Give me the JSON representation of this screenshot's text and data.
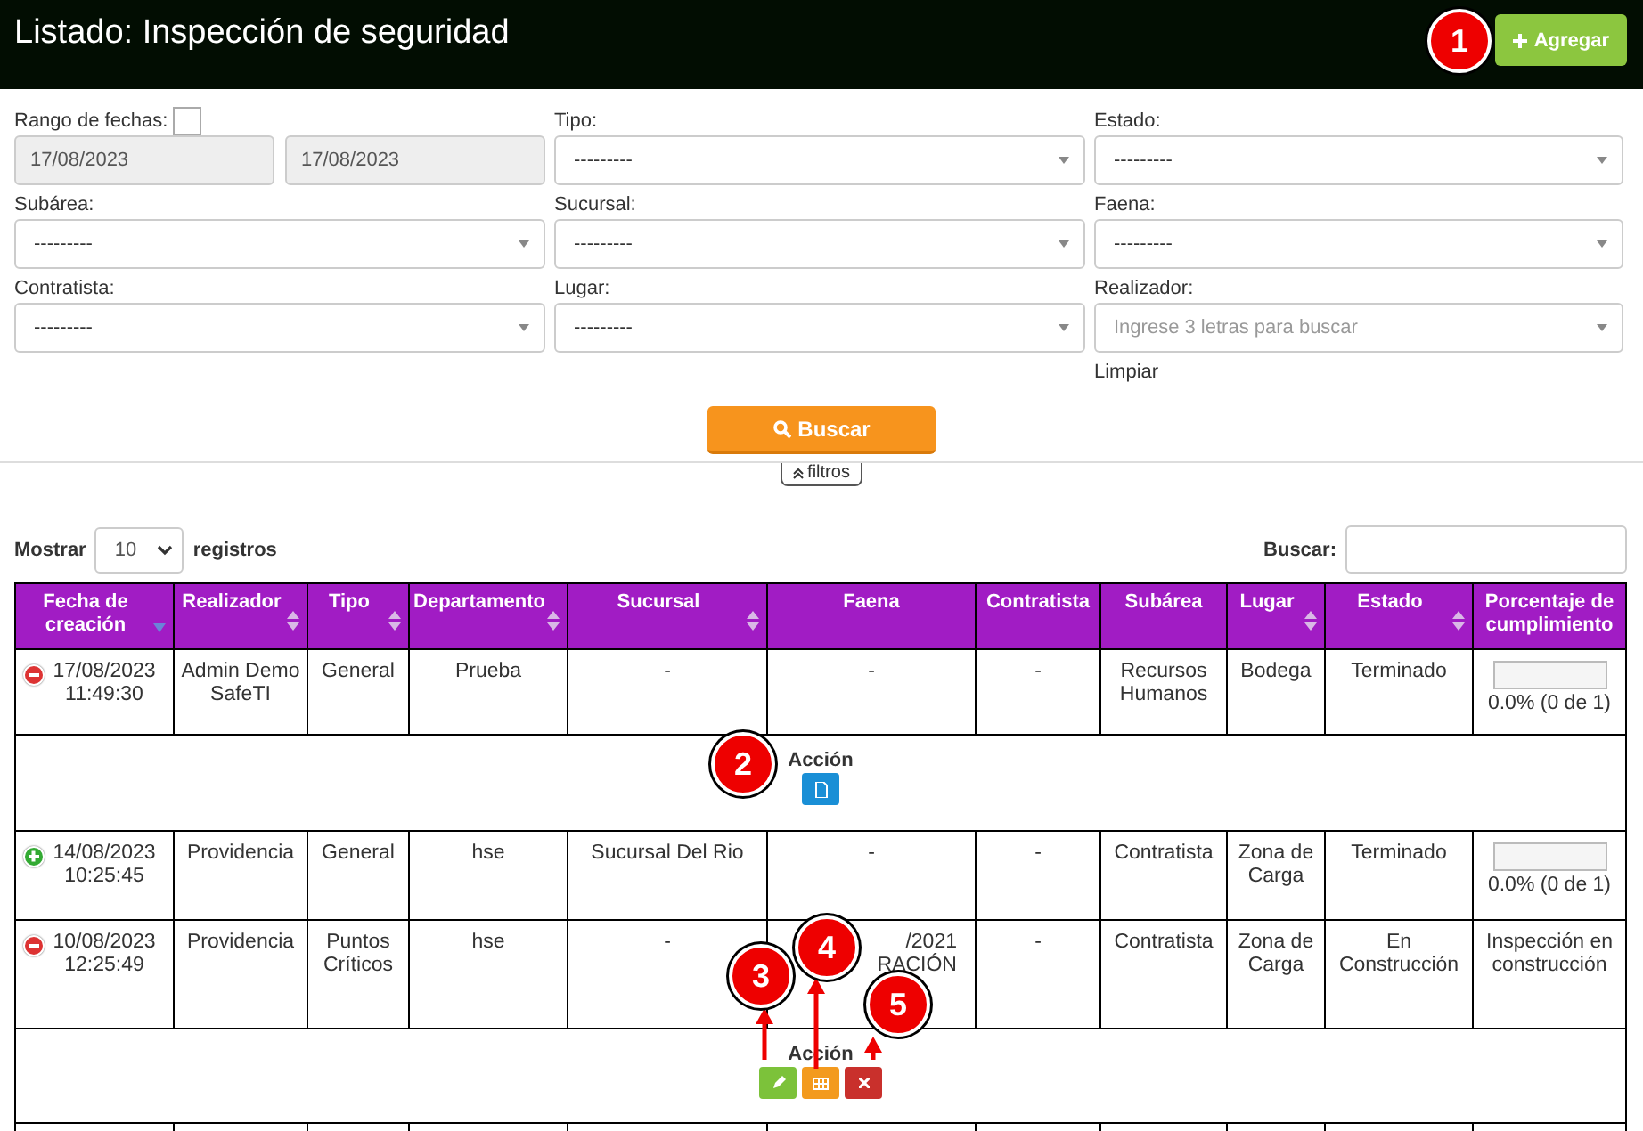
{
  "header": {
    "title": "Listado: Inspección de seguridad",
    "add_button": "Agregar"
  },
  "filters": {
    "fields": [
      {
        "kind": "date_range",
        "label": "Rango de fechas:",
        "checked": false,
        "from": "17/08/2023",
        "to": "17/08/2023"
      },
      {
        "kind": "select",
        "label": "Tipo:",
        "value": "---------"
      },
      {
        "kind": "select",
        "label": "Estado:",
        "value": "---------"
      },
      {
        "kind": "select",
        "label": "Subárea:",
        "value": "---------"
      },
      {
        "kind": "select",
        "label": "Sucursal:",
        "value": "---------"
      },
      {
        "kind": "select",
        "label": "Faena:",
        "value": "---------"
      },
      {
        "kind": "select",
        "label": "Contratista:",
        "value": "---------"
      },
      {
        "kind": "select",
        "label": "Lugar:",
        "value": "---------"
      },
      {
        "kind": "autocomplete",
        "label": "Realizador:",
        "placeholder": "Ingrese 3 letras para buscar",
        "link": "Limpiar"
      }
    ],
    "search_button": "Buscar",
    "toggle": "filtros"
  },
  "table_controls": {
    "show_label": "Mostrar",
    "page_size": "10",
    "records_label": "registros",
    "search_label": "Buscar:"
  },
  "table": {
    "columns": [
      {
        "label": "Fecha de creación",
        "sortable": true,
        "sorted_descending": true
      },
      {
        "label": "Realizador",
        "sortable": true,
        "sorted_descending": false
      },
      {
        "label": "Tipo",
        "sortable": true,
        "sorted_descending": false
      },
      {
        "label": "Departamento",
        "sortable": true,
        "sorted_descending": false
      },
      {
        "label": "Sucursal",
        "sortable": true,
        "sorted_descending": false
      },
      {
        "label": "Faena",
        "sortable": false,
        "sorted_descending": false
      },
      {
        "label": "Contratista",
        "sortable": false,
        "sorted_descending": false
      },
      {
        "label": "Subárea",
        "sortable": false,
        "sorted_descending": false
      },
      {
        "label": "Lugar",
        "sortable": true,
        "sorted_descending": false
      },
      {
        "label": "Estado",
        "sortable": true,
        "sorted_descending": false
      },
      {
        "label": "Porcentaje de cumplimiento",
        "sortable": false,
        "sorted_descending": false
      }
    ],
    "rows": [
      {
        "kind": "data",
        "expanded": true,
        "cells": [
          "17/08/2023\n11:49:30",
          "Admin Demo SafeTI",
          "General",
          "Prueba",
          "-",
          "-",
          "-",
          "Recursos Humanos",
          "Bodega",
          "Terminado"
        ],
        "completion": {
          "kind": "progress",
          "level": 0,
          "reading": "0.0% (0 de 1)"
        }
      },
      {
        "kind": "actions",
        "label": "Acción",
        "buttons": [
          {
            "kind": "pdf"
          }
        ]
      },
      {
        "kind": "data",
        "expanded": false,
        "cells": [
          "14/08/2023\n10:25:45",
          "Providencia",
          "General",
          "hse",
          "Sucursal Del Rio",
          "-",
          "-",
          "Contratista",
          "Zona de Carga",
          "Terminado"
        ],
        "completion": {
          "kind": "progress",
          "level": 0,
          "reading": "0.0% (0 de 1)"
        }
      },
      {
        "kind": "data",
        "expanded": true,
        "cells": [
          "10/08/2023\n12:25:49",
          "Providencia",
          "Puntos Críticos",
          "hse",
          "-",
          "/2021\nRACIÓN",
          "-",
          "Contratista",
          "Zona de Carga",
          "En Construcción"
        ],
        "completion": {
          "kind": "text",
          "text": "Inspección en construcción"
        }
      },
      {
        "kind": "actions",
        "label": "Acción",
        "buttons": [
          {
            "kind": "edit"
          },
          {
            "kind": "grid"
          },
          {
            "kind": "delete"
          }
        ]
      }
    ]
  },
  "callouts": [
    "1",
    "2",
    "3",
    "4",
    "5"
  ]
}
